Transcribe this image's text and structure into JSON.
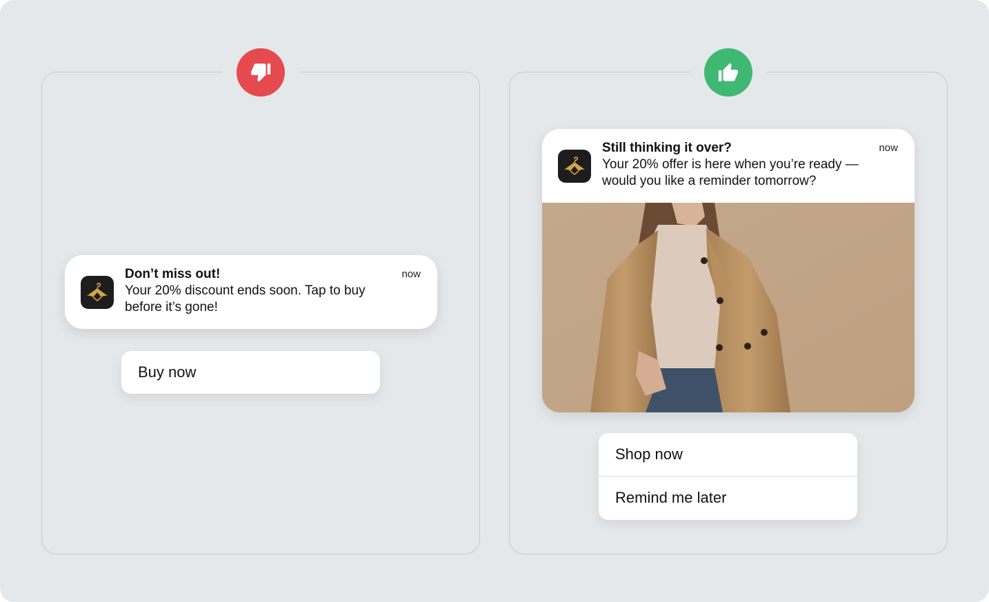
{
  "bad_example": {
    "badge_icon": "thumbs-down-icon",
    "badge_color": "#e54a4f",
    "notification": {
      "app_icon": "hanger-logo-icon",
      "title": "Don’t miss out!",
      "body": "Your 20% discount ends soon. Tap to buy before it’s gone!",
      "time": "now"
    },
    "actions": [
      "Buy now"
    ]
  },
  "good_example": {
    "badge_icon": "thumbs-up-icon",
    "badge_color": "#3fb871",
    "notification": {
      "app_icon": "hanger-logo-icon",
      "title": "Still thinking it over?",
      "body": "Your 20% offer is here when you’re ready — would you like a reminder tomorrow?",
      "time": "now",
      "image": "woman-in-trench-coat-photo"
    },
    "actions": [
      "Shop now",
      "Remind me later"
    ]
  },
  "colors": {
    "background": "#e5e8eb",
    "card": "#ffffff",
    "app_icon_bg": "#1d1d1d",
    "logo_gold": "#d4a545"
  }
}
